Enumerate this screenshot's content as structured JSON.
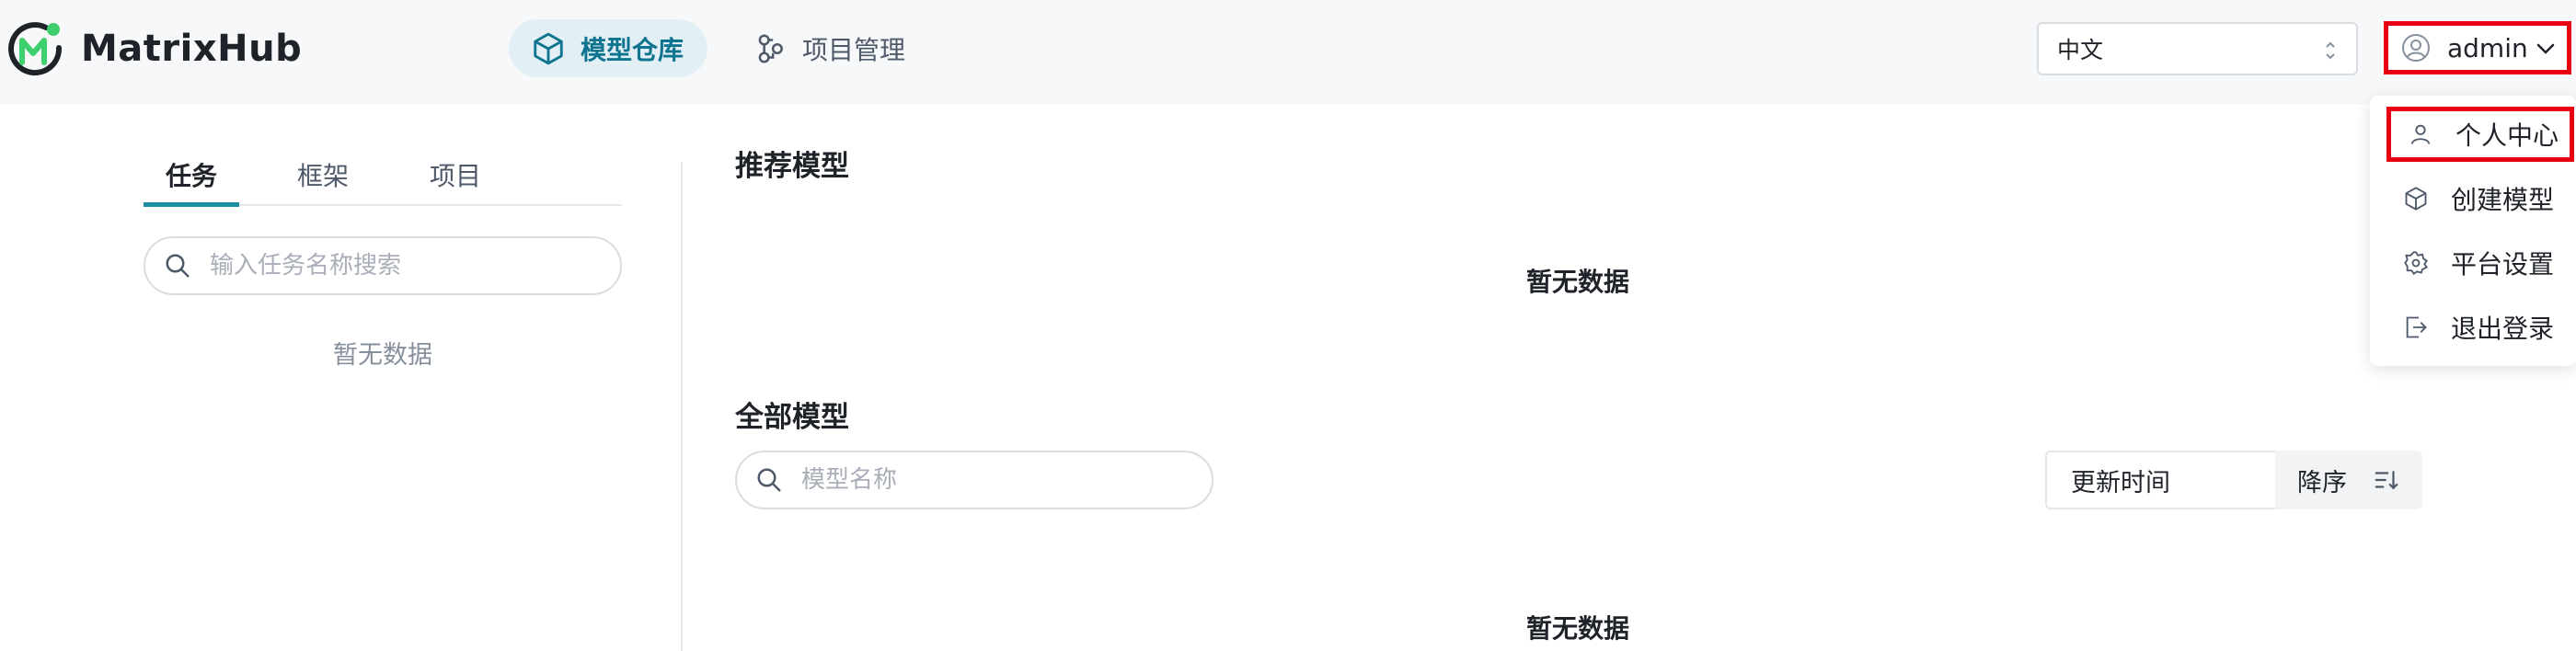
{
  "header": {
    "brand": "MatrixHub",
    "nav": [
      {
        "label": "模型仓库",
        "icon": "cube-icon",
        "active": true
      },
      {
        "label": "项目管理",
        "icon": "project-icon",
        "active": false
      }
    ],
    "language": {
      "selected": "中文"
    },
    "user": {
      "name": "admin"
    }
  },
  "user_menu": {
    "items": [
      {
        "label": "个人中心",
        "icon": "user-icon"
      },
      {
        "label": "创建模型",
        "icon": "cube-icon"
      },
      {
        "label": "平台设置",
        "icon": "gear-icon"
      },
      {
        "label": "退出登录",
        "icon": "logout-icon"
      }
    ]
  },
  "sidebar": {
    "tabs": [
      {
        "label": "任务",
        "active": true
      },
      {
        "label": "框架",
        "active": false
      },
      {
        "label": "项目",
        "active": false
      }
    ],
    "search_placeholder": "输入任务名称搜索",
    "empty_text": "暂无数据"
  },
  "main": {
    "recommended": {
      "title": "推荐模型",
      "empty_text": "暂无数据"
    },
    "all": {
      "title": "全部模型",
      "search_placeholder": "模型名称",
      "sort_field": "更新时间",
      "sort_order": "降序",
      "empty_text": "暂无数据"
    }
  },
  "colors": {
    "accent": "#1a8fa0",
    "highlight_border": "#e60012",
    "logo_green": "#3ecf6e",
    "logo_dark": "#1f2329"
  }
}
